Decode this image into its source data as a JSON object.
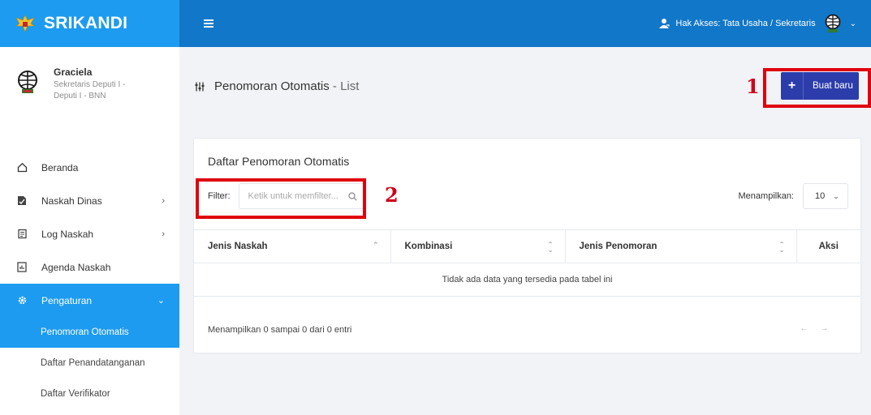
{
  "brand": {
    "name": "SRIKANDI"
  },
  "user": {
    "name": "Graciela",
    "role": "Sekretaris Deputi I - Deputi I - BNN"
  },
  "menu": {
    "items": [
      {
        "label": "Beranda",
        "icon": "home-icon"
      },
      {
        "label": "Naskah Dinas",
        "icon": "document-icon",
        "chevron": "›"
      },
      {
        "label": "Log Naskah",
        "icon": "log-icon",
        "chevron": "›"
      },
      {
        "label": "Agenda Naskah",
        "icon": "agenda-icon"
      },
      {
        "label": "Pengaturan",
        "icon": "gear-icon",
        "chevron": "⌄"
      }
    ],
    "sub_items": [
      {
        "label": "Penomoran Otomatis"
      },
      {
        "label": "Daftar Penandatanganan"
      },
      {
        "label": "Daftar Verifikator"
      }
    ]
  },
  "topbar": {
    "access": "Hak Akses: Tata Usaha / Sekretaris",
    "caret": "⌄"
  },
  "page": {
    "title_main": "Penomoran Otomatis",
    "title_sep": " - ",
    "title_sub": "List",
    "new_button": "Buat baru",
    "plus": "+"
  },
  "annotations": {
    "one": "1",
    "two": "2"
  },
  "card": {
    "title": "Daftar Penomoran Otomatis",
    "filter_label": "Filter:",
    "filter_placeholder": "Ketik untuk memfilter...",
    "show_label": "Menampilkan:",
    "show_value": "10",
    "show_caret": "⌄",
    "columns": [
      "Jenis Naskah",
      "Kombinasi",
      "Jenis Penomoran",
      "Aksi"
    ],
    "empty_message": "Tidak ada data yang tersedia pada tabel ini",
    "footer": "Menampilkan 0 sampai 0 dari 0 entri",
    "pager_prev": "←",
    "pager_next": "→"
  },
  "colors": {
    "primary": "#1d9bf0",
    "topbar": "#1177c8",
    "button": "#2c3dab",
    "highlight": "#e0000e"
  }
}
